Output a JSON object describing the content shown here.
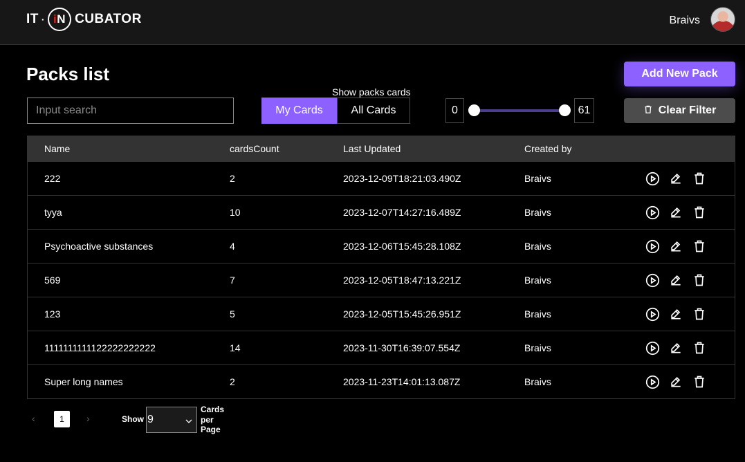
{
  "header": {
    "logo_it": "IT",
    "logo_dot": "·",
    "logo_in_i": "i",
    "logo_in_n": "N",
    "logo_cubator": "CUBATOR",
    "user_name": "Braivs"
  },
  "main": {
    "title": "Packs list",
    "add_button": "Add New Pack",
    "search_placeholder": "Input search",
    "search_value": "",
    "show_label": "Show packs cards",
    "toggle_my": "My Cards",
    "toggle_all": "All Cards",
    "range_min": "0",
    "range_max": "61",
    "range_fraction_min": 0,
    "range_fraction_max": 1,
    "clear_button": "Clear Filter"
  },
  "table": {
    "headers": {
      "name": "Name",
      "count": "cardsCount",
      "updated": "Last Updated",
      "created": "Created by"
    },
    "rows": [
      {
        "name": "222",
        "count": "2",
        "updated": "2023-12-09T18:21:03.490Z",
        "created": "Braivs"
      },
      {
        "name": "tyya",
        "count": "10",
        "updated": "2023-12-07T14:27:16.489Z",
        "created": "Braivs"
      },
      {
        "name": "Psychoactive substances",
        "count": "4",
        "updated": "2023-12-06T15:45:28.108Z",
        "created": "Braivs"
      },
      {
        "name": "569",
        "count": "7",
        "updated": "2023-12-05T18:47:13.221Z",
        "created": "Braivs"
      },
      {
        "name": "123",
        "count": "5",
        "updated": "2023-12-05T15:45:26.951Z",
        "created": "Braivs"
      },
      {
        "name": "1111111111122222222222",
        "count": "14",
        "updated": "2023-11-30T16:39:07.554Z",
        "created": "Braivs"
      },
      {
        "name": "Super long names",
        "count": "2",
        "updated": "2023-11-23T14:01:13.087Z",
        "created": "Braivs"
      }
    ],
    "row_icons": [
      "play-circle-icon",
      "pencil-icon",
      "trash-icon"
    ]
  },
  "pagination": {
    "prev": "‹",
    "current_page": "1",
    "next": "›",
    "show_label": "Show",
    "per_page_value": "9",
    "per_label_1": "Cards",
    "per_label_2": "per",
    "per_label_3": "Page"
  },
  "colors": {
    "accent": "#8c61ff",
    "clear_button_bg": "#4c4c4c",
    "table_header_bg": "#333333",
    "background": "#000000"
  }
}
